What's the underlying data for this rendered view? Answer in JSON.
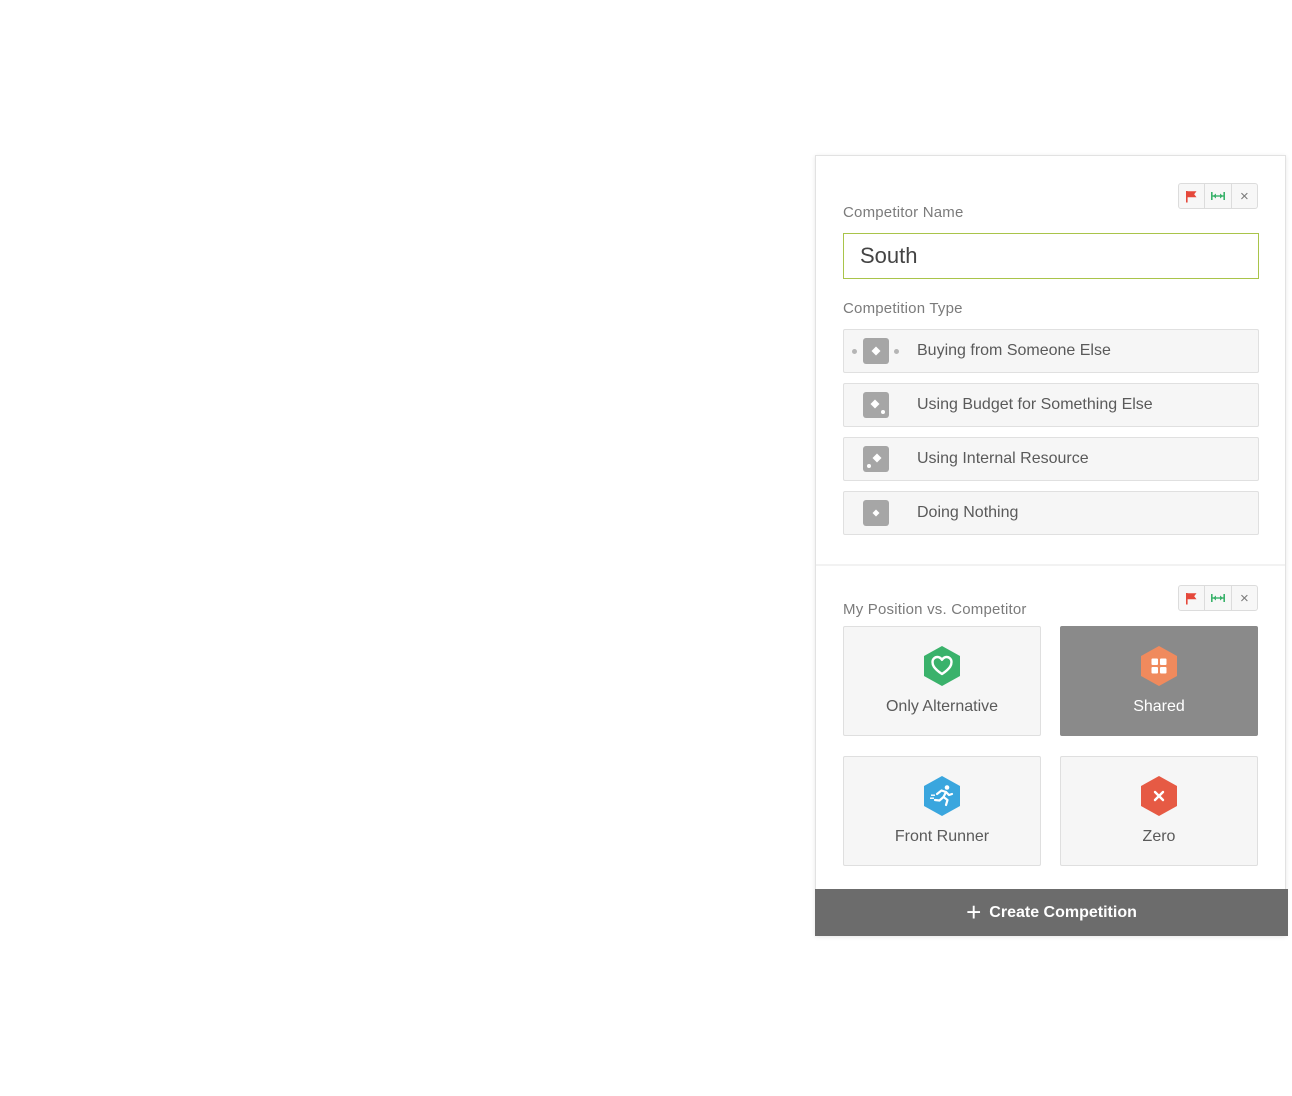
{
  "competitor_name": {
    "label": "Competitor Name",
    "value": "South"
  },
  "competition_type": {
    "label": "Competition Type",
    "options": [
      {
        "label": "Buying from Someone Else",
        "icon": "diamond-center-icon"
      },
      {
        "label": "Using Budget for Something Else",
        "icon": "diamond-corner-br-icon"
      },
      {
        "label": "Using Internal Resource",
        "icon": "diamond-corner-bl-icon"
      },
      {
        "label": "Doing Nothing",
        "icon": "diamond-icon"
      }
    ]
  },
  "position": {
    "label": "My Position vs. Competitor",
    "options": [
      {
        "label": "Only Alternative",
        "icon": "heart-icon",
        "color": "#3ab26b",
        "selected": false
      },
      {
        "label": "Shared",
        "icon": "grid-icon",
        "color": "#f08a5d",
        "selected": true
      },
      {
        "label": "Front Runner",
        "icon": "runner-icon",
        "color": "#3aa6de",
        "selected": false
      },
      {
        "label": "Zero",
        "icon": "x-icon",
        "color": "#e65a44",
        "selected": false
      }
    ]
  },
  "toolbar": {
    "flag_color": "#e5483b",
    "resize_color": "#3ab26b",
    "close_label": "×"
  },
  "create_button": {
    "label": "Create Competition",
    "plus": "+"
  }
}
